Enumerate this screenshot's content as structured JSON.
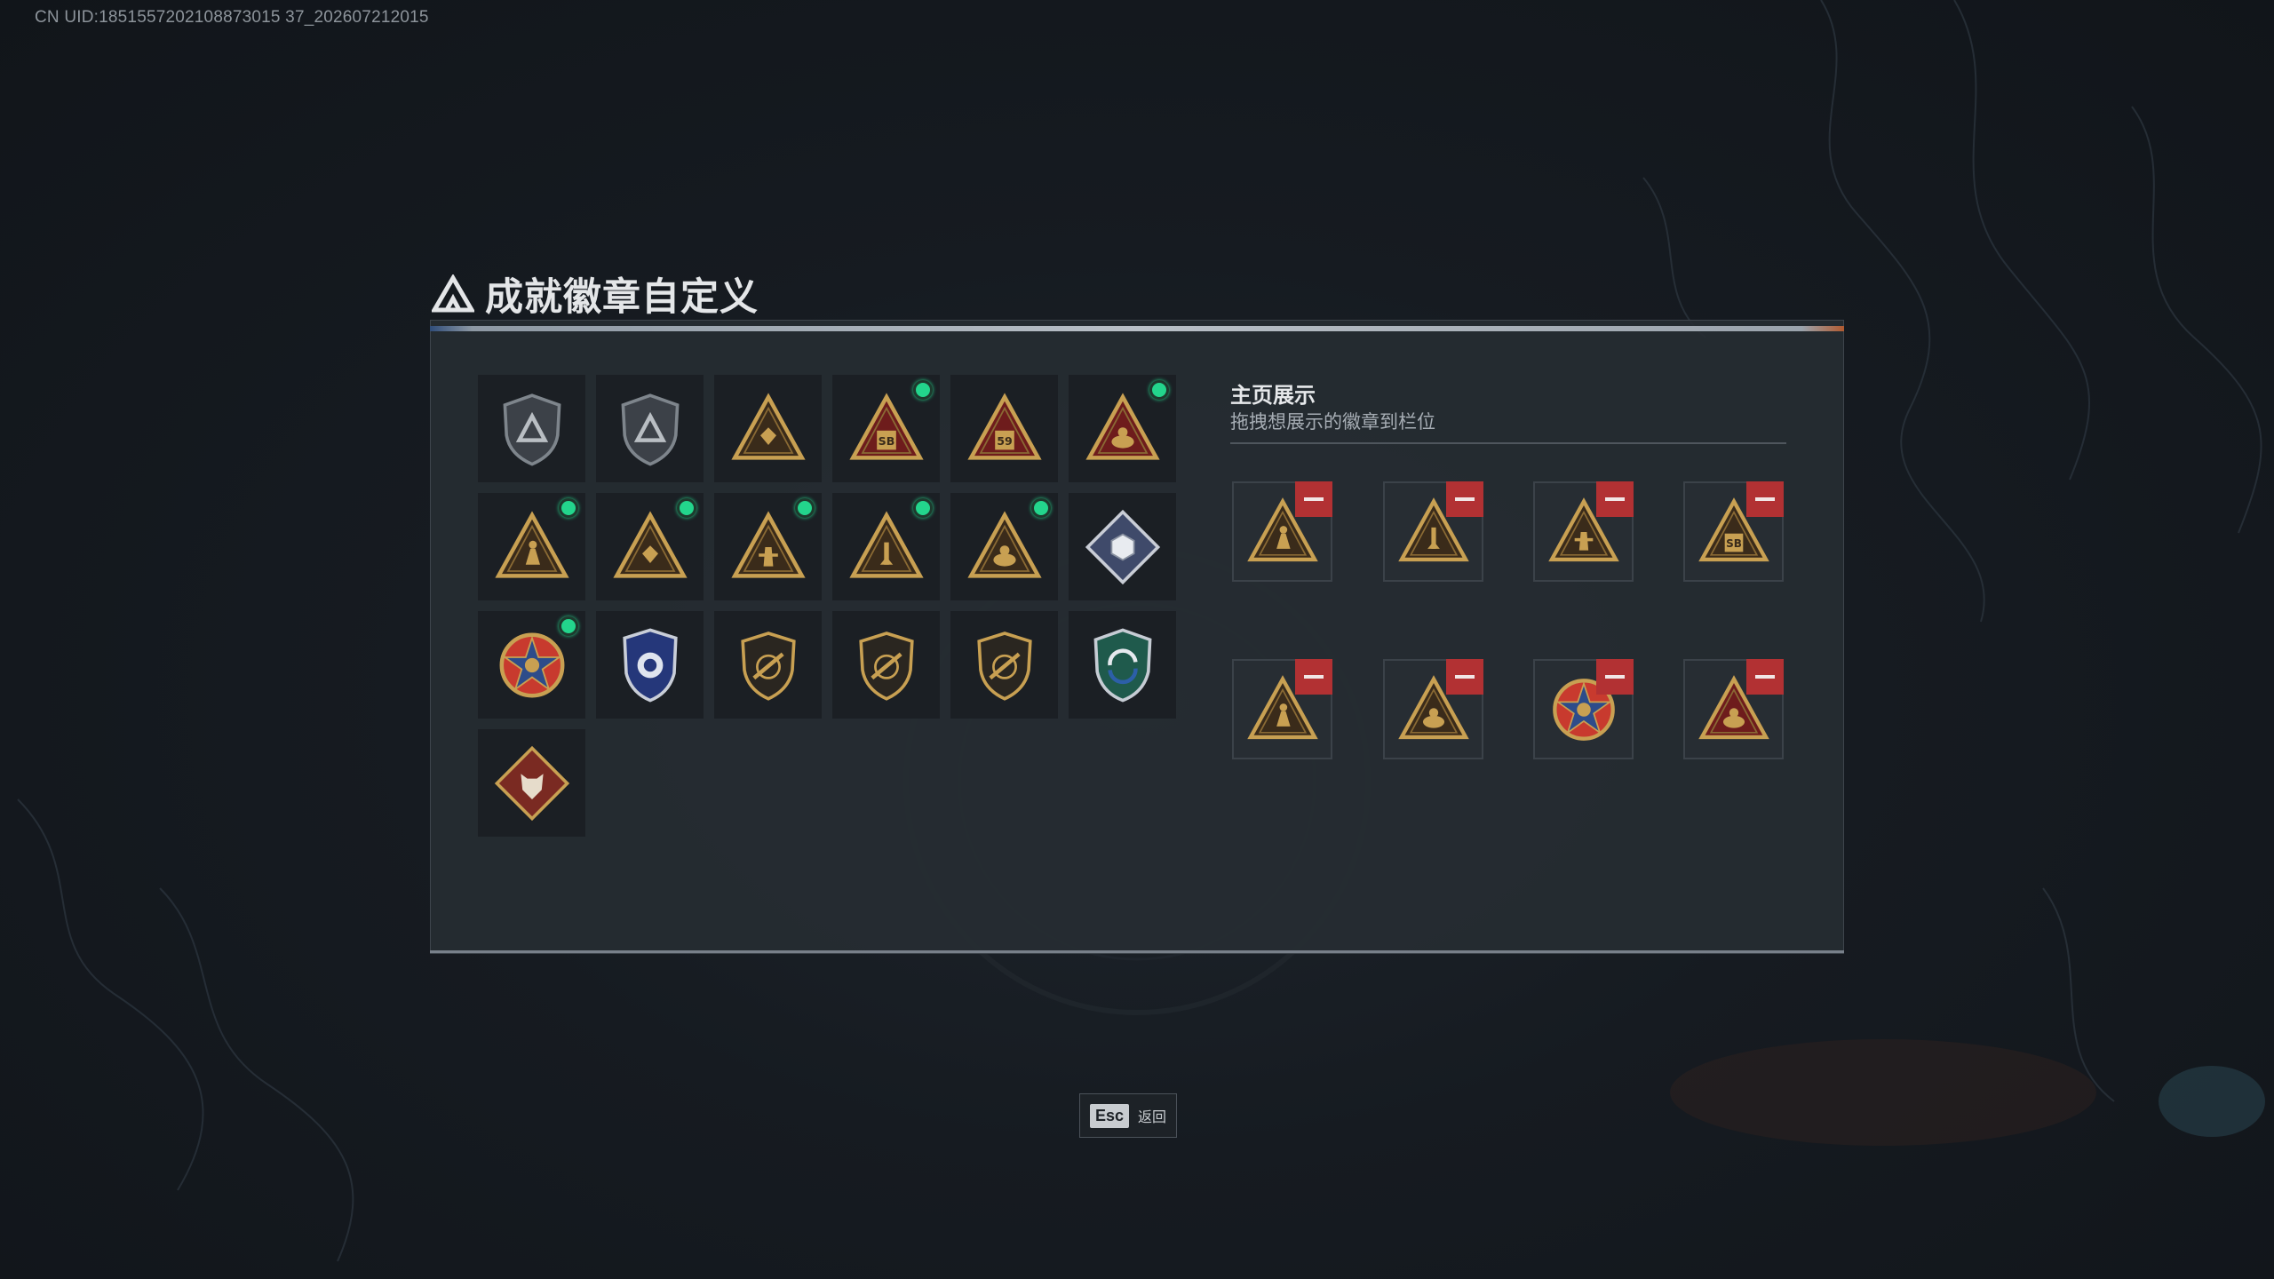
{
  "uid": "CN UID:1851557202108873015 37_202607212015",
  "title": "成就徽章自定义",
  "title_small": "",
  "colors": {
    "gold": "#c8a052",
    "dark_red": "#6e1c1c",
    "green_dot": "#23d58c",
    "remove_red": "#b23133",
    "panel_bg": "#262c32"
  },
  "badges": [
    {
      "icon": "triangle-logo-shield-icon",
      "equipped": false,
      "style": "grey-shield"
    },
    {
      "icon": "helicopter-shield-icon",
      "equipped": false,
      "style": "grey-shield"
    },
    {
      "icon": "card-triangle-icon",
      "equipped": false,
      "style": "gold-triangle"
    },
    {
      "icon": "sb-card-triangle-icon",
      "equipped": true,
      "style": "red-triangle",
      "text": "SB"
    },
    {
      "icon": "winged-emblem-triangle-icon",
      "equipped": false,
      "style": "red-triangle",
      "text": "59"
    },
    {
      "icon": "hand-sign-triangle-icon",
      "equipped": true,
      "style": "red-triangle"
    },
    {
      "icon": "hand-bowl-triangle-icon",
      "equipped": true,
      "style": "gold-triangle"
    },
    {
      "icon": "kneeling-soldier-triangle-icon",
      "equipped": true,
      "style": "gold-triangle"
    },
    {
      "icon": "gem-hands-triangle-icon",
      "equipped": true,
      "style": "gold-triangle"
    },
    {
      "icon": "soldier-stars-triangle-icon",
      "equipped": true,
      "style": "gold-triangle"
    },
    {
      "icon": "rocket-triangle-icon",
      "equipped": true,
      "style": "gold-triangle"
    },
    {
      "icon": "cube-diamond-icon",
      "equipped": false,
      "style": "silver-diamond"
    },
    {
      "icon": "star-eagle-emblem-icon",
      "equipped": true,
      "style": "star-emblem"
    },
    {
      "icon": "blue-police-badge-icon",
      "equipped": false,
      "style": "blue-badge"
    },
    {
      "icon": "gem-shield-icon",
      "equipped": false,
      "style": "dark-gold-shield"
    },
    {
      "icon": "sniper-shield-icon",
      "equipped": false,
      "style": "dark-gold-shield"
    },
    {
      "icon": "rifle-shield-icon",
      "equipped": false,
      "style": "dark-gold-shield"
    },
    {
      "icon": "recycle-shield-icon",
      "equipped": false,
      "style": "green-shield"
    },
    {
      "icon": "wolf-diamond-icon",
      "equipped": false,
      "style": "wolf-diamond"
    }
  ],
  "display": {
    "title": "主页展示",
    "subtitle": "拖拽想展示的徽章到栏位",
    "slots": [
      {
        "icon": "hand-bowl-triangle-icon",
        "style": "gold-triangle"
      },
      {
        "icon": "soldier-stars-triangle-icon",
        "style": "gold-triangle"
      },
      {
        "icon": "gem-hands-triangle-icon",
        "style": "gold-triangle"
      },
      {
        "icon": "sb-card-triangle-icon",
        "style": "gold-triangle",
        "text": "SB"
      },
      {
        "icon": "hand-bowl-triangle-icon",
        "style": "gold-triangle"
      },
      {
        "icon": "rocket-triangle-icon",
        "style": "gold-triangle"
      },
      {
        "icon": "star-eagle-emblem-icon",
        "style": "star-emblem"
      },
      {
        "icon": "hand-sign-triangle-icon",
        "style": "red-triangle"
      }
    ]
  },
  "footer": {
    "esc_key": "Esc",
    "back_label": "返回"
  }
}
